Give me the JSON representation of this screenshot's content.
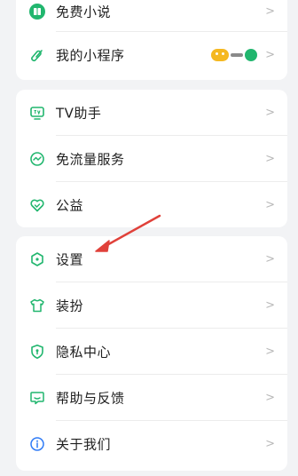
{
  "menu": {
    "group1": [
      {
        "label": "免费小说",
        "icon": "book-icon",
        "chevron": ">"
      },
      {
        "label": "我的小程序",
        "icon": "mini-program-icon",
        "chevron": ">",
        "badges": [
          "yellow-face-icon",
          "green-leaf-icon"
        ]
      }
    ],
    "group2": [
      {
        "label": "TV助手",
        "icon": "tv-icon",
        "chevron": ">"
      },
      {
        "label": "免流量服务",
        "icon": "traffic-icon",
        "chevron": ">"
      },
      {
        "label": "公益",
        "icon": "heart-icon",
        "chevron": ">"
      }
    ],
    "group3": [
      {
        "label": "设置",
        "icon": "settings-icon",
        "chevron": ">"
      },
      {
        "label": "装扮",
        "icon": "shirt-icon",
        "chevron": ">"
      },
      {
        "label": "隐私中心",
        "icon": "privacy-shield-icon",
        "chevron": ">"
      },
      {
        "label": "帮助与反馈",
        "icon": "feedback-icon",
        "chevron": ">"
      },
      {
        "label": "关于我们",
        "icon": "info-icon",
        "chevron": ">"
      }
    ]
  },
  "colors": {
    "accent": "#21b66e",
    "background": "#f2f3f5",
    "annotation_arrow": "#e0413a"
  }
}
